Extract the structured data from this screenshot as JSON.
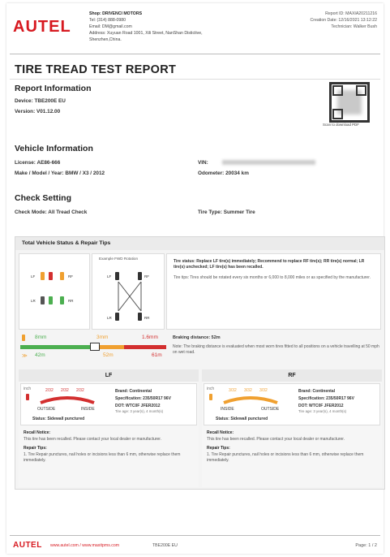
{
  "header": {
    "logo": "AUTEL",
    "shop": "Shop: DRIVENCI MOTORS",
    "tel": "Tel: (314) 888-0980",
    "email": "Email: DM@gmail.com",
    "address1": "Address: Xuyuan Road 1001, Xili Street, NanShan Distictive,",
    "address2": "Shenzhen,China.",
    "report_id": "Report ID: MAXIA20211216",
    "creation_date": "Creation Date: 12/16/2021 13:12:22",
    "technician": "Technician: Walker Bush"
  },
  "title": "TIRE TREAD TEST REPORT",
  "report_info": {
    "heading": "Report Information",
    "device": "Device: TBE200E EU",
    "version": "Version: V01.12.00",
    "qr_caption": "Scan to download PDF"
  },
  "vehicle": {
    "heading": "Vehicle Information",
    "license": "License: AE86-666",
    "make": "Make / Model / Year: BMW / X3 / 2012",
    "vin_label": "VIN:",
    "odometer": "Odometer: 20034 km"
  },
  "check": {
    "heading": "Check Setting",
    "mode": "Check Mode: All Tread Check",
    "type": "Tire Type: Summer Tire"
  },
  "status": {
    "heading": "Total Vehicle Status & Repair Tips",
    "rotation_label": "Example FWD Rotation",
    "tire_labels": [
      "LF",
      "RF",
      "LR",
      "RR"
    ],
    "status_text": "Tire status: Replace LF tire(s) immediately; Recommend to replace RF tire(s); RR tire(s) normal; LR tire(s) unchecked; LF tire(s) has been recalled.",
    "tips_text": "Tire tips: Tires should be rotated every six months or 6,000 to 8,000 miles or as specified by the manufacturer.",
    "tread_green": "8mm",
    "tread_orange": "3mm",
    "tread_red": "1.6mm",
    "dist_green": "42m",
    "dist_orange": "52m",
    "dist_red": "61m",
    "braking": "Braking distance: 52m",
    "braking_note": "Note: The braking distance is evaluated when most worn tires fitted to all positions on a vehicle travelling at 50 mph on wet road.",
    "colors": {
      "green": "#4caf50",
      "orange": "#f0a030",
      "red": "#d32f2f"
    }
  },
  "tires": [
    {
      "name": "LF",
      "unit": "inch",
      "readings": [
        "2/32",
        "2/32",
        "2/32"
      ],
      "outside": "OUTSIDE",
      "inside": "INSIDE",
      "brand": "Brand: Continental",
      "spec": "Specification: 235/50R17 96V",
      "dot": "DOT: WTC0F JFER2012",
      "age": "Tire age: 3 year(s), 4 month(s)",
      "status": "Status: Sidewall punctured",
      "recall_h": "Recall Notice:",
      "recall": "This tire has been recalled. Please contact your local dealer or manufacturer.",
      "repair_h": "Repair Tips:",
      "repair": "1. Tire Repair punctures, nail holes or incisions less than 6 mm, otherwise replace them immediately."
    },
    {
      "name": "RF",
      "unit": "inch",
      "readings": [
        "3/32",
        "3/32",
        "3/32"
      ],
      "outside": "INSIDE",
      "inside": "OUTSIDE",
      "brand": "Brand: Continental",
      "spec": "Specification: 235/50R17 96V",
      "dot": "DOT: WTC0F JFER2012",
      "age": "Tire age: 3 year(s), 4 month(s)",
      "status": "Status: Sidewall punctured",
      "recall_h": "Recall Notice:",
      "recall": "This tire has been recalled. Please contact your local dealer or manufacturer.",
      "repair_h": "Repair Tips:",
      "repair": "1. Tire Repair punctures, nail holes or incisions less than 6 mm, otherwise replace them immediately."
    }
  ],
  "footer": {
    "logo": "AUTEL",
    "links": "www.autel.com  /  www.maxitpms.com",
    "device": "TBE200E EU",
    "page": "Page: 1 / 2"
  }
}
